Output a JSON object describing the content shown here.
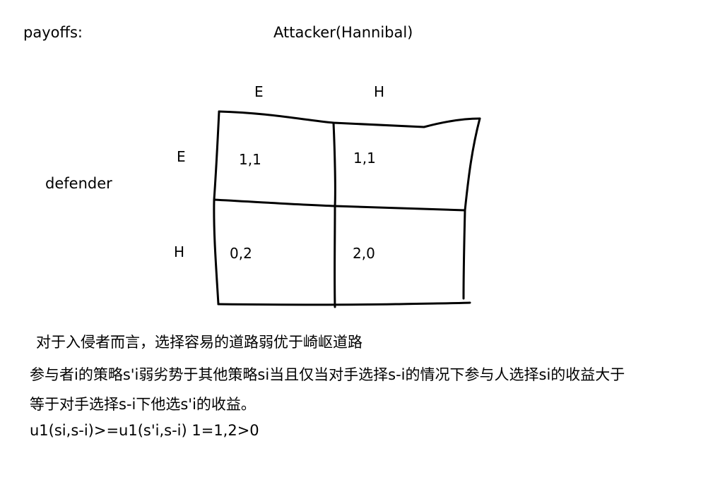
{
  "labels": {
    "payoffs": "payoffs:",
    "attacker": "Attacker(Hannibal)",
    "defender": "defender"
  },
  "columns": {
    "e": "E",
    "h": "H"
  },
  "rows": {
    "e": "E",
    "h": "H"
  },
  "cells": {
    "ee": "1,1",
    "eh": "1,1",
    "he": "0,2",
    "hh": "2,0"
  },
  "notes": {
    "line1": "对于入侵者而言，选择容易的道路弱优于崎岖道路",
    "line2": "参与者i的策略s'i弱劣势于其他策略si当且仅当对手选择s-i的情况下参与人选择si的收益大于",
    "line3": "等于对手选择s-i下他选s'i的收益。",
    "formula": "u1(si,s-i)>=u1(s'i,s-i) 1=1,2>0"
  }
}
